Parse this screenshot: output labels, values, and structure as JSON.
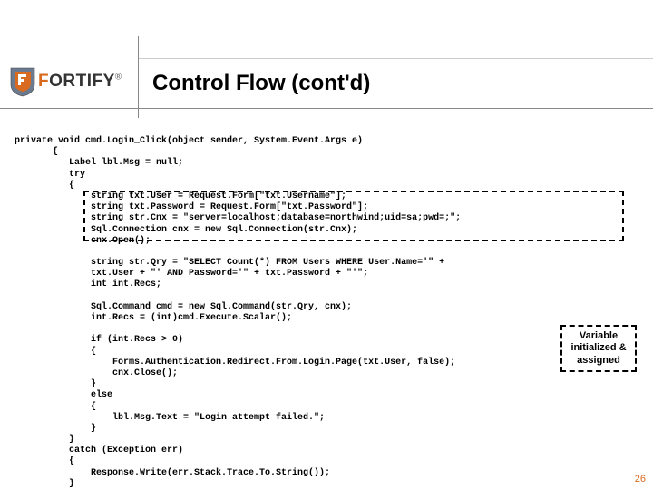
{
  "logo": {
    "brand_first": "F",
    "brand_rest": "ORTIFY",
    "reg": "®"
  },
  "title": "Control Flow (cont'd)",
  "callout": "Variable initialized & assigned",
  "page_number": "26",
  "code": {
    "l01": "private void cmd.Login_Click(object sender, System.Event.Args e)",
    "l02": "       {",
    "l03": "          Label lbl.Msg = null;",
    "l04": "          try",
    "l05": "          {",
    "l06": "              string txt.User = Request.Form[\"txt.Username\"];",
    "l07": "              string txt.Password = Request.Form[\"txt.Password\"];",
    "l08": "              string str.Cnx = \"server=localhost;database=northwind;uid=sa;pwd=;\";",
    "l09": "              Sql.Connection cnx = new Sql.Connection(str.Cnx);",
    "l10": "              cnx.Open();",
    "l11": "",
    "l12": "              string str.Qry = \"SELECT Count(*) FROM Users WHERE User.Name='\" +",
    "l13": "              txt.User + \"' AND Password='\" + txt.Password + \"'\";",
    "l14": "              int int.Recs;",
    "l15": "",
    "l16": "              Sql.Command cmd = new Sql.Command(str.Qry, cnx);",
    "l17": "              int.Recs = (int)cmd.Execute.Scalar();",
    "l18": "",
    "l19": "              if (int.Recs > 0)",
    "l20": "              {",
    "l21": "                  Forms.Authentication.Redirect.From.Login.Page(txt.User, false);",
    "l22": "                  cnx.Close();",
    "l23": "              }",
    "l24": "              else",
    "l25": "              {",
    "l26": "                  lbl.Msg.Text = \"Login attempt failed.\";",
    "l27": "              }",
    "l28": "          }",
    "l29": "          catch (Exception err)",
    "l30": "          {",
    "l31": "              Response.Write(err.Stack.Trace.To.String());",
    "l32": "          }"
  }
}
